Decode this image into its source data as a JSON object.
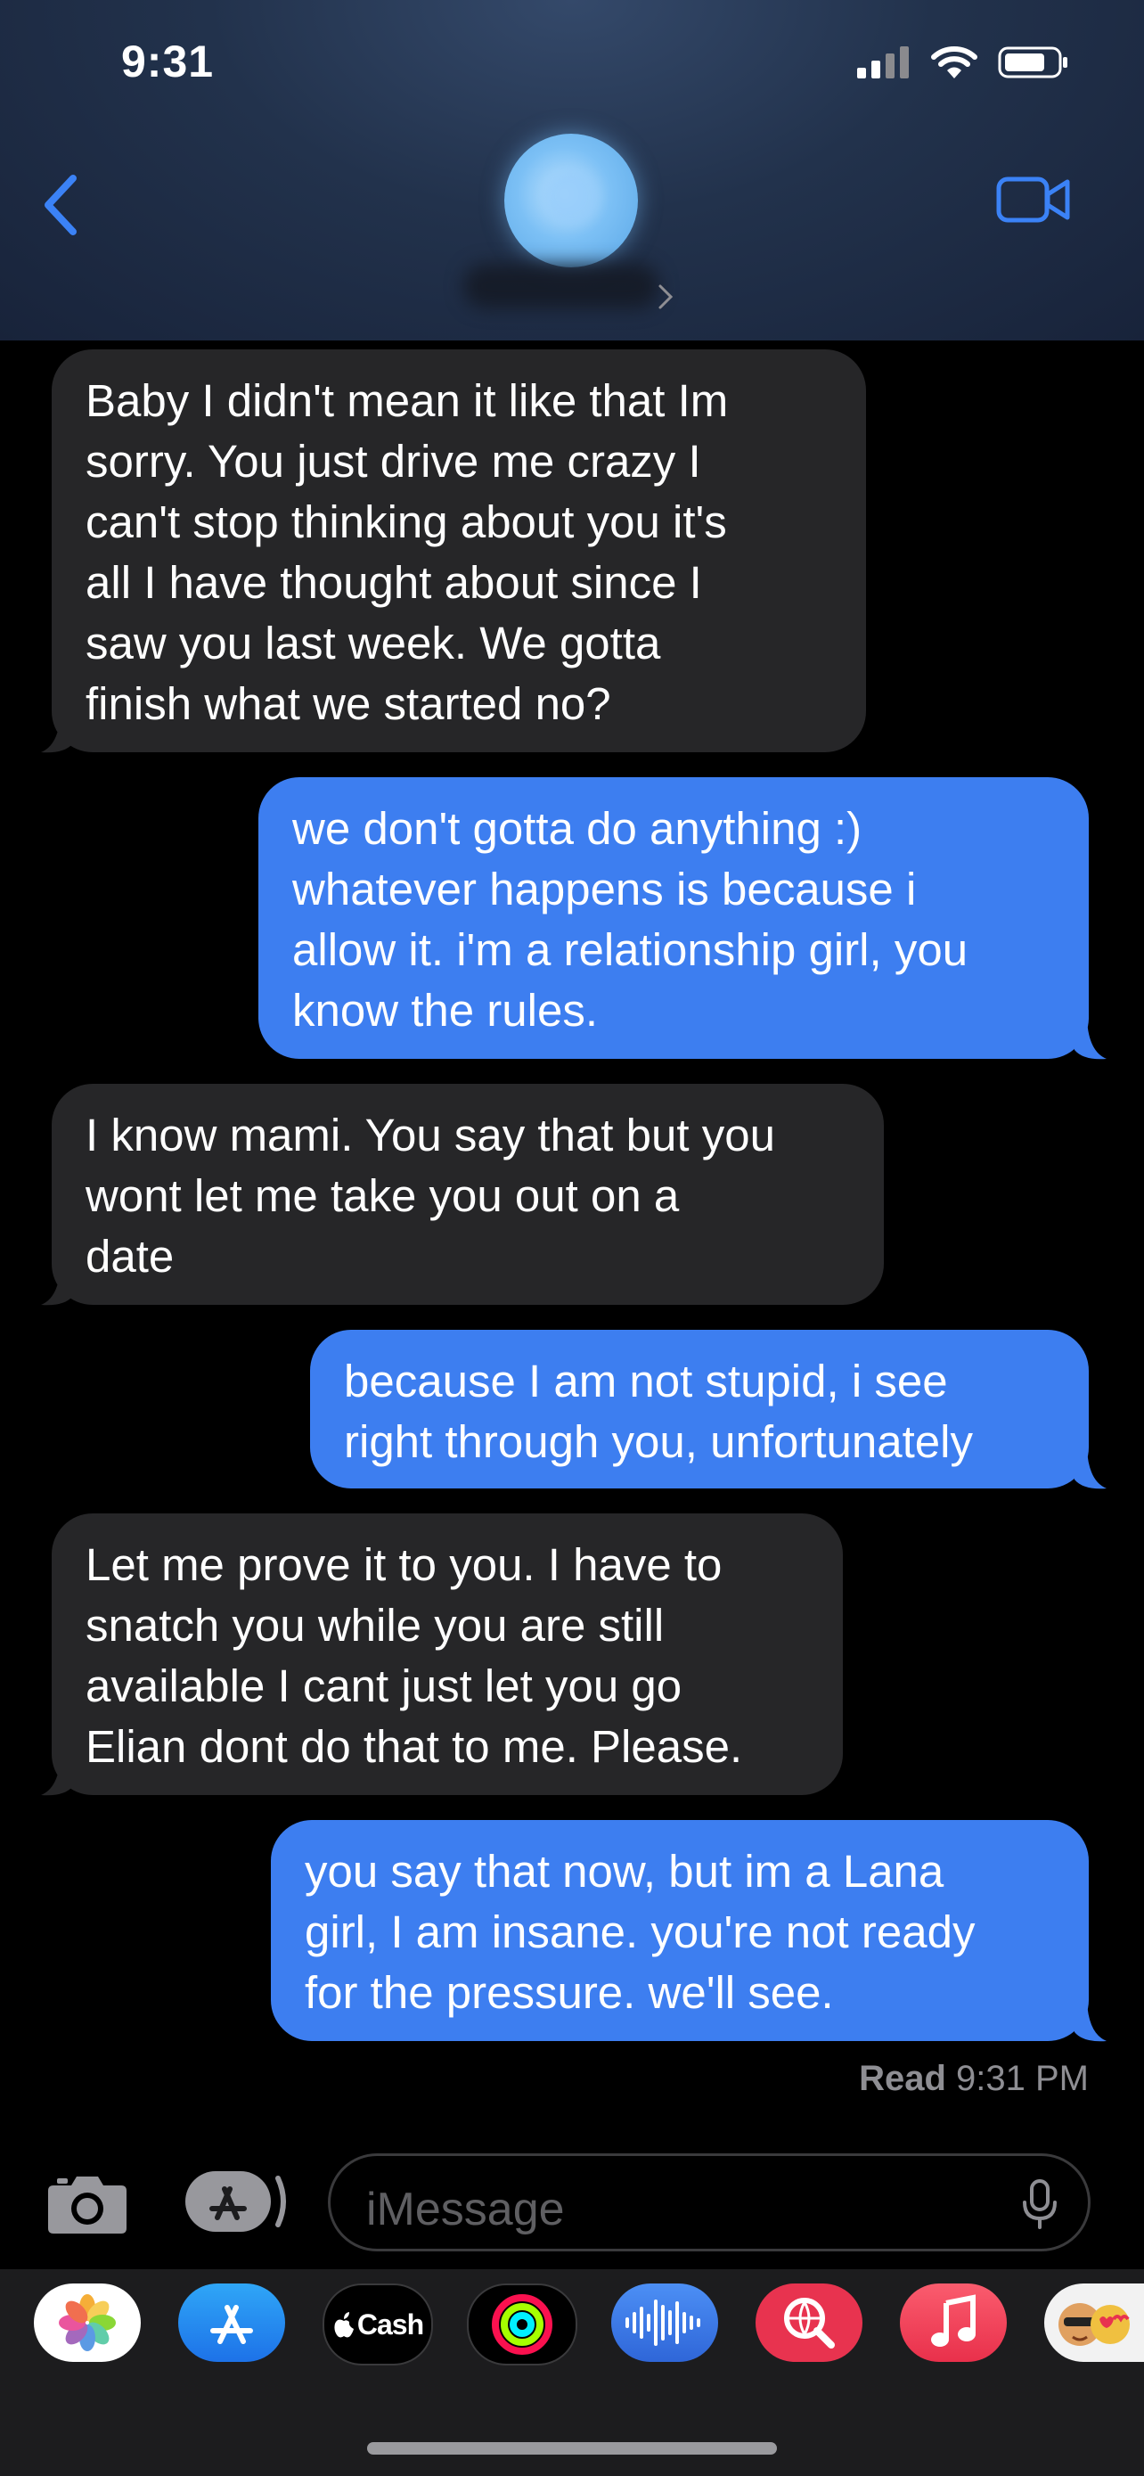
{
  "status_bar": {
    "time": "9:31"
  },
  "header": {
    "back_icon": "chevron-left-icon",
    "video_icon": "video-camera-icon"
  },
  "messages": [
    {
      "direction": "received",
      "text": "Baby I didn't mean it like that Im\nsorry. You just drive me crazy I\ncan't stop thinking about you it's\nall I have thought about since I\nsaw you last week. We gotta\nfinish what we started no?"
    },
    {
      "direction": "sent",
      "text": "we don't gotta do anything :)\nwhatever happens is because i\nallow it. i'm a relationship girl, you\nknow the rules."
    },
    {
      "direction": "received",
      "text": "I know mami. You say that but you\nwont let me take you out on a\ndate"
    },
    {
      "direction": "sent",
      "text": "because I am not stupid, i see\nright through you, unfortunately"
    },
    {
      "direction": "received",
      "text": "Let me prove it to you. I have to\nsnatch you while you are still\navailable I cant just let you go\nElian dont do that to me. Please."
    },
    {
      "direction": "sent",
      "text": "you say that now, but im a Lana\ngirl, I am insane. you're not ready\nfor the pressure. we'll see."
    }
  ],
  "read_receipt": {
    "label": "Read",
    "time": "9:31 PM"
  },
  "input": {
    "placeholder": "iMessage"
  },
  "app_drawer": {
    "apps": [
      {
        "name": "Photos",
        "icon": "photos-icon"
      },
      {
        "name": "App Store",
        "icon": "app-store-icon"
      },
      {
        "name": "Cash",
        "label": "Cash",
        "icon": "apple-cash-icon"
      },
      {
        "name": "Fitness",
        "icon": "activity-rings-icon"
      },
      {
        "name": "Audio",
        "icon": "audio-waveform-icon"
      },
      {
        "name": "Search",
        "icon": "web-search-icon"
      },
      {
        "name": "Music",
        "icon": "music-note-icon"
      },
      {
        "name": "Memoji",
        "icon": "memoji-icon"
      }
    ]
  },
  "colors": {
    "sent_bubble": "#3d7ef0",
    "received_bubble": "#262628",
    "accent": "#3b82f6"
  }
}
